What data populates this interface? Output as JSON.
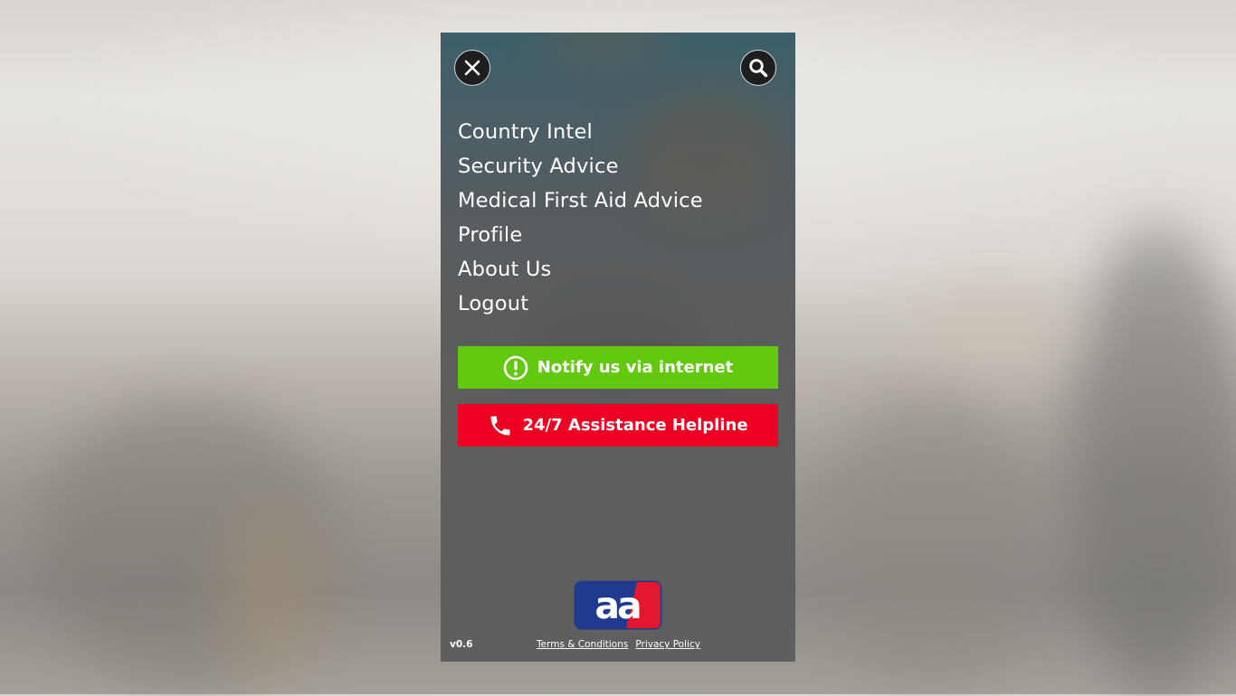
{
  "colors": {
    "notify_bg": "#63c90f",
    "helpline_bg": "#ee0022",
    "logo_blue": "#1f3a8f",
    "logo_red": "#e3172d"
  },
  "header": {
    "close_icon": "close-icon",
    "search_icon": "search-icon"
  },
  "menu": {
    "items": [
      {
        "label": "Country Intel"
      },
      {
        "label": "Security Advice"
      },
      {
        "label": "Medical First Aid Advice"
      },
      {
        "label": "Profile"
      },
      {
        "label": "About Us"
      },
      {
        "label": "Logout"
      }
    ]
  },
  "actions": {
    "notify": {
      "label": "Notify us via internet",
      "icon": "alert-circle-icon"
    },
    "helpline": {
      "label": "24/7 Assistance Helpline",
      "icon": "phone-icon"
    }
  },
  "logo": {
    "text": "aa"
  },
  "footer": {
    "version": "v0.6",
    "terms": "Terms & Conditions",
    "privacy": "Privacy Policy"
  }
}
